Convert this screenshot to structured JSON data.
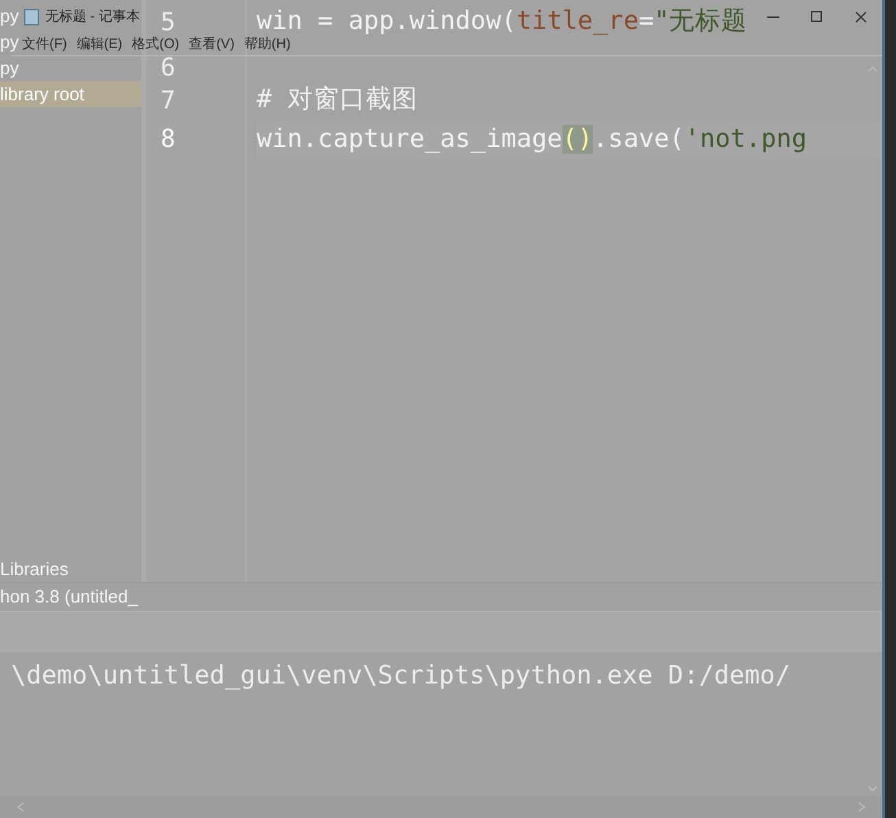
{
  "notepad": {
    "title": "无标题 - 记事本",
    "menu": [
      "文件(F)",
      "编辑(E)",
      "格式(O)",
      "查看(V)",
      "帮助(H)"
    ]
  },
  "project_tree": [
    {
      "label": "py",
      "selected": false
    },
    {
      "label": "py",
      "selected": false
    },
    {
      "label": "py",
      "selected": false
    },
    {
      "label": "library root",
      "selected": true
    },
    {
      "label": "Libraries",
      "selected": false
    },
    {
      "label": "hon 3.8 (untitled_",
      "selected": false
    }
  ],
  "editor": {
    "lines": [
      {
        "number": "5",
        "current": false,
        "tokens": [
          {
            "kind": "plain",
            "text": "win = app.window("
          },
          {
            "kind": "param",
            "text": "title_re"
          },
          {
            "kind": "plain",
            "text": "="
          },
          {
            "kind": "string",
            "text": "\"无标题"
          }
        ]
      },
      {
        "number": "6",
        "current": false
      },
      {
        "number": "7",
        "current": false,
        "tokens": [
          {
            "kind": "comment",
            "text": "# 对窗口截图"
          }
        ]
      },
      {
        "number": "8",
        "current": true,
        "tokens": [
          {
            "kind": "plain",
            "text": "win.capture_as_image"
          },
          {
            "kind": "brace",
            "text": "()"
          },
          {
            "kind": "plain",
            "text": ".save("
          },
          {
            "kind": "string",
            "text": "'not.png"
          }
        ]
      }
    ]
  },
  "console": {
    "lines": [
      "\\demo\\untitled_gui\\venv\\Scripts\\python.exe D:/demo/"
    ]
  }
}
